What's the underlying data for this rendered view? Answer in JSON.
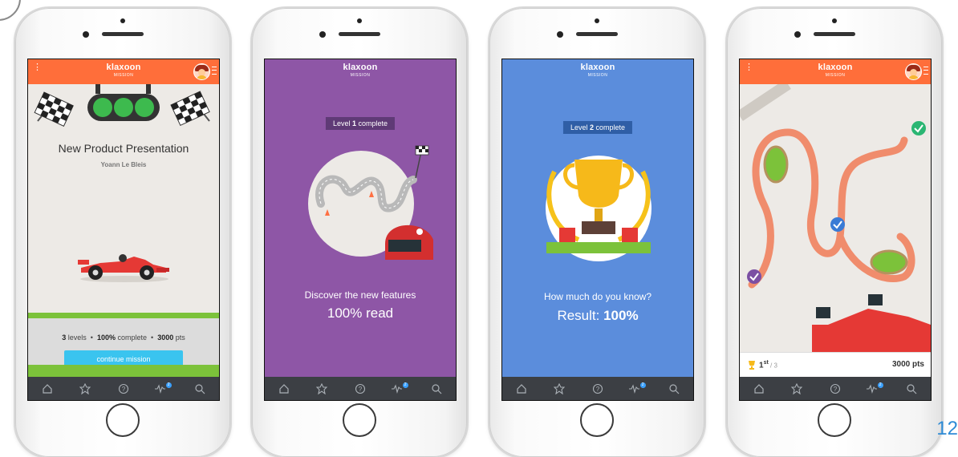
{
  "app": {
    "brand_name": "klaxoon",
    "brand_sub": "MISSION"
  },
  "screen1": {
    "title": "New Product Presentation",
    "author": "Yoann Le Bleis",
    "levels_count": "3",
    "levels_label": "levels",
    "complete_value": "100%",
    "complete_label": "complete",
    "points_value": "3000",
    "points_label": "pts",
    "cta_label": "continue mission"
  },
  "screen2": {
    "badge_prefix": "Level ",
    "badge_level": "1",
    "badge_suffix": " complete",
    "line1": "Discover the new features",
    "line2": "100% read"
  },
  "screen3": {
    "badge_prefix": "Level ",
    "badge_level": "2",
    "badge_suffix": " complete",
    "line1": "How much do you know?",
    "result_label": "Result: ",
    "result_value": "100%"
  },
  "screen4": {
    "rank": "1",
    "rank_suffix": "st",
    "rank_of": " / 3",
    "points": "3000 pts"
  },
  "nav": {
    "badge": "2"
  },
  "page_number": "12",
  "colors": {
    "header": "#ff6e3a",
    "purple": "#8e56a6",
    "blue": "#5b8ddc",
    "cta": "#3ac4ef",
    "nav": "#3c3f44"
  }
}
